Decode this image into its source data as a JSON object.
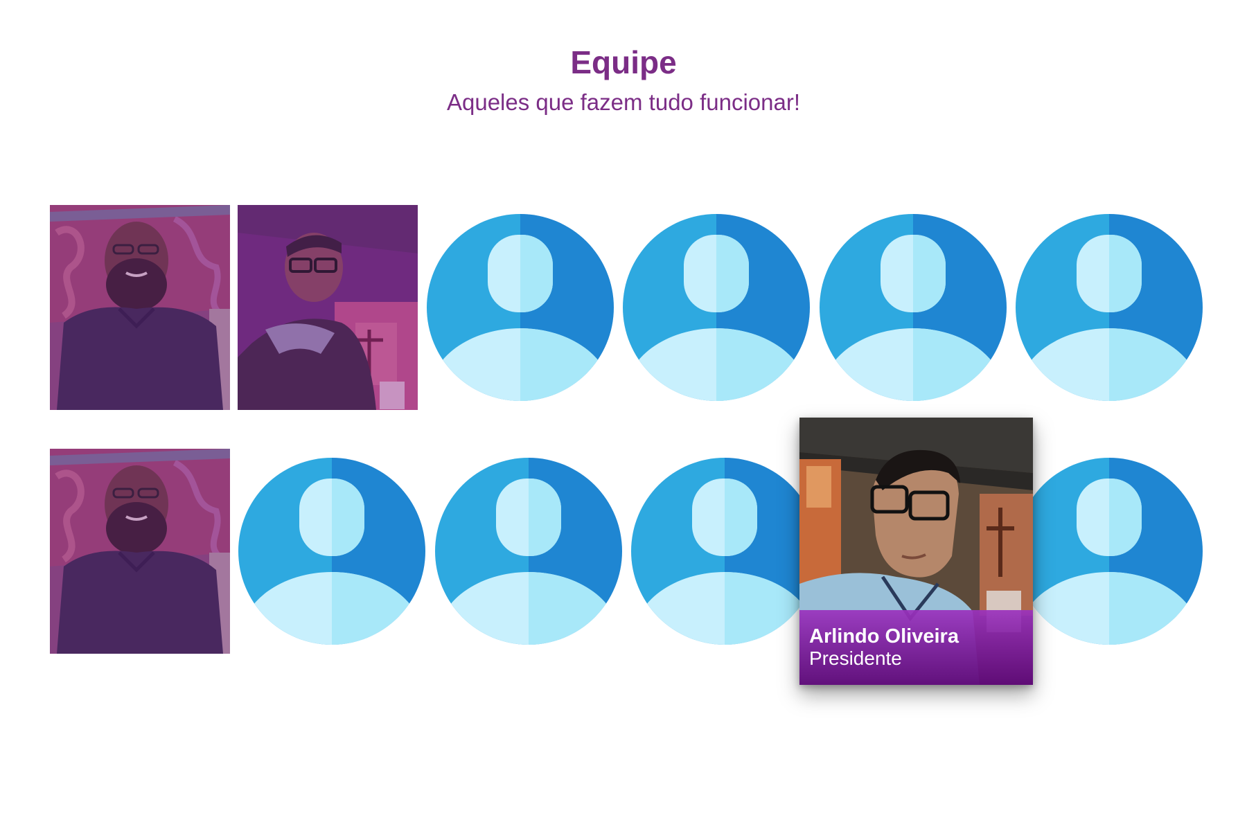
{
  "section": {
    "title": "Equipe",
    "subtitle": "Aqueles que fazem tudo funcionar!"
  },
  "team": {
    "highlighted_member": {
      "name": "Arlindo Oliveira",
      "role": "Presidente"
    }
  },
  "colors": {
    "accent": "#7b2d86",
    "avatar_light_blue": "#2ea9e0",
    "avatar_dark_blue": "#1f86d2",
    "avatar_head_light": "#c8f0fd",
    "avatar_head_dark": "#a8e8f9",
    "photo_overlay": "#7a2a8c"
  }
}
